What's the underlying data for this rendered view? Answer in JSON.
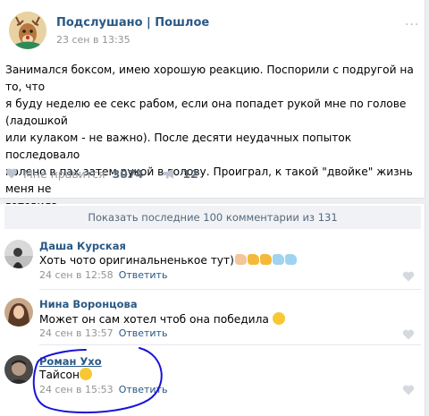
{
  "post": {
    "group_name": "Подслушано | Пошлое",
    "date": "23 сен в 13:35",
    "menu": "···",
    "text_lines": [
      "Занимался боксом, имею хорошую реакцию. Поспорили с подругой на то, что",
      "я буду неделю ее секс рабом, если она попадет рукой мне по голове (ладошкой",
      "или кулаком - не важно). После десяти неудачных попыток последовало",
      "колено в пах затем рукой в голову. Проиграл, к такой \"двойке\" жизнь меня не",
      "готовила."
    ],
    "likes_label": "Мне нравится",
    "likes_count": "3074",
    "shares_count": "12"
  },
  "comments": {
    "show_more": "Показать последние 100 комментарии из 131",
    "items": [
      {
        "name": "Даша Курская",
        "text": "Хоть чото оригинальненькое тут)",
        "date": "24 сен в 12:58",
        "reply": "Ответить"
      },
      {
        "name": "Нина Воронцова",
        "text": "Может он сам хотел чтоб она победила",
        "date": "24 сен в 13:57",
        "reply": "Ответить"
      },
      {
        "name": "Роман Ухо",
        "text": "Тайсон",
        "date": "24 сен в 15:53",
        "reply": "Ответить"
      }
    ]
  },
  "colors": {
    "link": "#2a5885",
    "muted": "#939393",
    "annotation": "#1a12d8"
  }
}
